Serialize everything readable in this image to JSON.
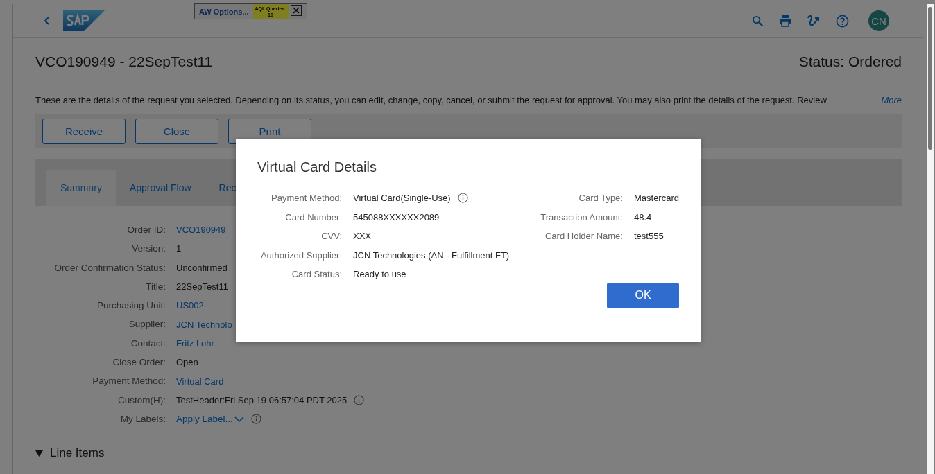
{
  "header": {
    "aw_options": "AW Options...",
    "aql_label": "AQL Queries:",
    "aql_count": "10",
    "avatar": "CN"
  },
  "page": {
    "title": "VCO190949 - 22SepTest11",
    "status": "Status: Ordered",
    "description": "These are the details of the request you selected. Depending on its status, you can edit, change, copy, cancel, or submit the request for approval. You may also print the details of the request. Review",
    "more_link": "More"
  },
  "actions": [
    "Receive",
    "Close",
    "Print"
  ],
  "tabs": [
    {
      "label": "Summary",
      "selected": true
    },
    {
      "label": "Approval Flow",
      "selected": false
    },
    {
      "label": "Rec",
      "selected": false
    }
  ],
  "fields": [
    {
      "label": "Order ID:",
      "value": "VCO190949",
      "kind": "link"
    },
    {
      "label": "Version:",
      "value": "1",
      "kind": "text"
    },
    {
      "label": "Order Confirmation Status:",
      "value": "Unconfirmed",
      "kind": "text"
    },
    {
      "label": "Title:",
      "value": "22SepTest11",
      "kind": "text"
    },
    {
      "label": "Purchasing Unit:",
      "value": "US002",
      "kind": "link"
    },
    {
      "label": "Supplier:",
      "value": "JCN Technolo",
      "kind": "link"
    },
    {
      "label": "Contact:",
      "value": "Fritz Lohr :",
      "kind": "link"
    },
    {
      "label": "Close Order:",
      "value": "Open",
      "kind": "text"
    },
    {
      "label": "Payment Method:",
      "value": "Virtual Card",
      "kind": "link"
    },
    {
      "label": "Custom(H):",
      "value": "TestHeader:Fri Sep 19 06:57:04 PDT 2025",
      "kind": "text",
      "info": true
    },
    {
      "label": "My Labels:",
      "value": "Apply Label...",
      "kind": "menu",
      "info": true
    }
  ],
  "section": {
    "title": "Line Items",
    "expanded": true
  },
  "dialog": {
    "title": "Virtual Card Details",
    "left": [
      {
        "label": "Payment Method:",
        "value": "Virtual Card(Single-Use)",
        "info": true
      },
      {
        "label": "Card Number:",
        "value": "545088XXXXXX2089",
        "info": false
      },
      {
        "label": "CVV:",
        "value": "XXX",
        "info": false
      },
      {
        "label": "Authorized Supplier:",
        "value": "JCN Technologies (AN - Fulfillment FT)",
        "info": false
      },
      {
        "label": "Card Status:",
        "value": "Ready to use",
        "info": false
      }
    ],
    "right": [
      {
        "label": "Card Type:",
        "value": "Mastercard",
        "info": false
      },
      {
        "label": "Transaction Amount:",
        "value": "48.4",
        "info": false
      },
      {
        "label": "Card Holder Name:",
        "value": "test555",
        "info": false
      }
    ],
    "ok": "OK"
  }
}
